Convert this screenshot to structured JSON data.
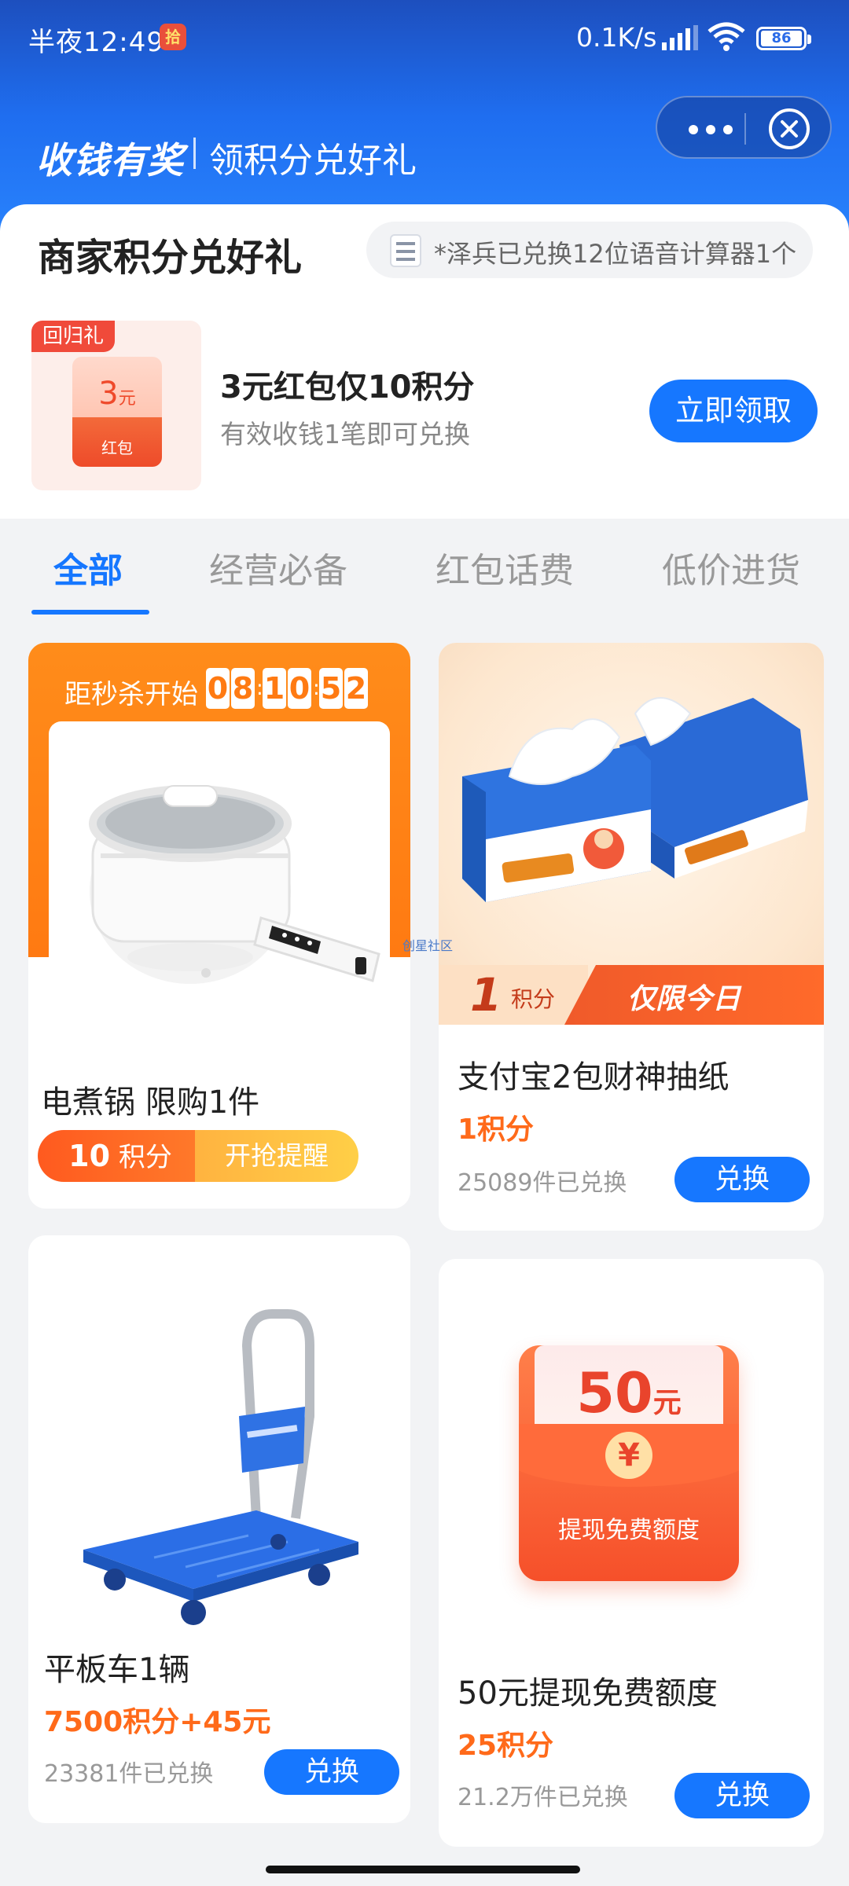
{
  "status_bar": {
    "time": "半夜12:49",
    "badge": "拾",
    "speed": "0.1K/s",
    "battery": "86"
  },
  "header": {
    "brand": "收钱有奖",
    "subtitle": "领积分兑好礼",
    "menu_icon": "more-dots-icon",
    "close_icon": "close-circle-icon"
  },
  "section": {
    "title": "商家积分兑好礼",
    "ticker": "*泽兵已兑换12位语音计算器1个"
  },
  "promo": {
    "tag": "回归礼",
    "amount": "3",
    "amount_unit": "元",
    "card_label": "红包",
    "title": "3元红包仅10积分",
    "subtitle": "有效收钱1笔即可兑换",
    "button": "立即领取"
  },
  "tabs": [
    {
      "label": "全部",
      "active": true
    },
    {
      "label": "经营必备",
      "active": false
    },
    {
      "label": "红包话费",
      "active": false
    },
    {
      "label": "低价进货",
      "active": false
    }
  ],
  "products": [
    {
      "flash_label": "距秒杀开始",
      "countdown": [
        "0",
        "8",
        "1",
        "0",
        "5",
        "2"
      ],
      "name": "电煮锅 限购1件",
      "points": "10",
      "points_unit": "积分",
      "remind": "开抢提醒"
    },
    {
      "ribbon_points": "1",
      "ribbon_unit": "积分",
      "ribbon_tag": "仅限今日",
      "name": "支付宝2包财神抽纸",
      "price": "1积分",
      "count": "25089件已兑换",
      "button": "兑换"
    },
    {
      "name": "平板车1辆",
      "price": "7500积分+45元",
      "count": "23381件已兑换",
      "button": "兑换"
    },
    {
      "image_amount": "50",
      "image_unit": "元",
      "image_coin": "¥",
      "image_caption": "提现免费额度",
      "name": "50元提现免费额度",
      "price": "25积分",
      "count": "21.2万件已兑换",
      "button": "兑换"
    }
  ],
  "watermark": "创星社区",
  "colors": {
    "primary": "#1677ff",
    "accent": "#ff6a1a",
    "header_top": "#1d4fbe"
  }
}
